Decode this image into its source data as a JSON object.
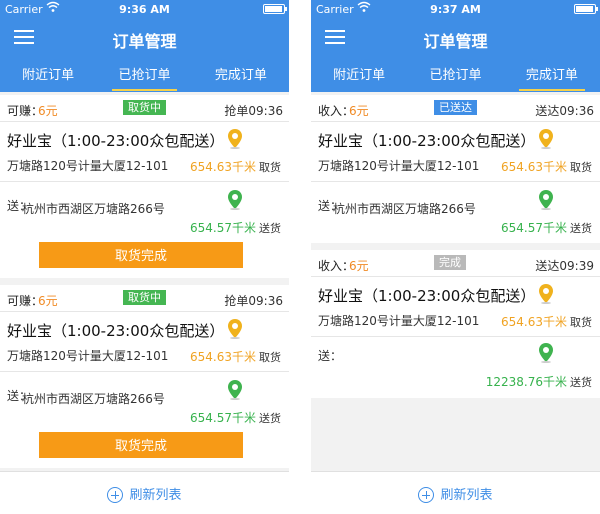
{
  "colors": {
    "header_blue": "#3f8ee6",
    "orange": "#f79a16",
    "green": "#45b652"
  },
  "left": {
    "status": {
      "carrier": "Carrier",
      "time": "9:36 AM"
    },
    "title": "订单管理",
    "tabs": [
      "附近订单",
      "已抢订单",
      "完成订单"
    ],
    "orders": [
      {
        "earn_label": "可赚：",
        "amount": "6元",
        "badge": "取货中",
        "time": "抢单09:36",
        "shop": "好业宝（1:00-23:00众包配送）",
        "shop_address": "万塘路120号计量大厦12-101",
        "pickup_distance": "654.63千米",
        "pickup_tail": "取货",
        "deliver_label": "送：",
        "deliver_address": "杭州市西湖区万塘路266号",
        "deliver_distance": "654.57千米",
        "deliver_tail": "送货",
        "button": "取货完成"
      },
      {
        "earn_label": "可赚：",
        "amount": "6元",
        "badge": "取货中",
        "time": "抢单09:36",
        "shop": "好业宝（1:00-23:00众包配送）",
        "shop_address": "万塘路120号计量大厦12-101",
        "pickup_distance": "654.63千米",
        "pickup_tail": "取货",
        "deliver_label": "送：",
        "deliver_address": "杭州市西湖区万塘路266号",
        "deliver_distance": "654.57千米",
        "deliver_tail": "送货",
        "button": "取货完成"
      }
    ],
    "refresh": "刷新列表"
  },
  "right": {
    "status": {
      "carrier": "Carrier",
      "time": "9:37 AM"
    },
    "title": "订单管理",
    "tabs": [
      "附近订单",
      "已抢订单",
      "完成订单"
    ],
    "orders": [
      {
        "earn_label": "收入：",
        "amount": "6元",
        "badge": "已送达",
        "time": "送达09:36",
        "shop": "好业宝（1:00-23:00众包配送）",
        "shop_address": "万塘路120号计量大厦12-101",
        "pickup_distance": "654.63千米",
        "pickup_tail": "取货",
        "deliver_label": "送：",
        "deliver_address": "杭州市西湖区万塘路266号",
        "deliver_distance": "654.57千米",
        "deliver_tail": "送货"
      },
      {
        "earn_label": "收入：",
        "amount": "6元",
        "badge": "完成",
        "time": "送达09:39",
        "shop": "好业宝（1:00-23:00众包配送）",
        "shop_address": "万塘路120号计量大厦12-101",
        "pickup_distance": "654.63千米",
        "pickup_tail": "取货",
        "deliver_label": "送：",
        "deliver_distance": "12238.76千米",
        "deliver_tail": "送货"
      }
    ],
    "refresh": "刷新列表"
  }
}
